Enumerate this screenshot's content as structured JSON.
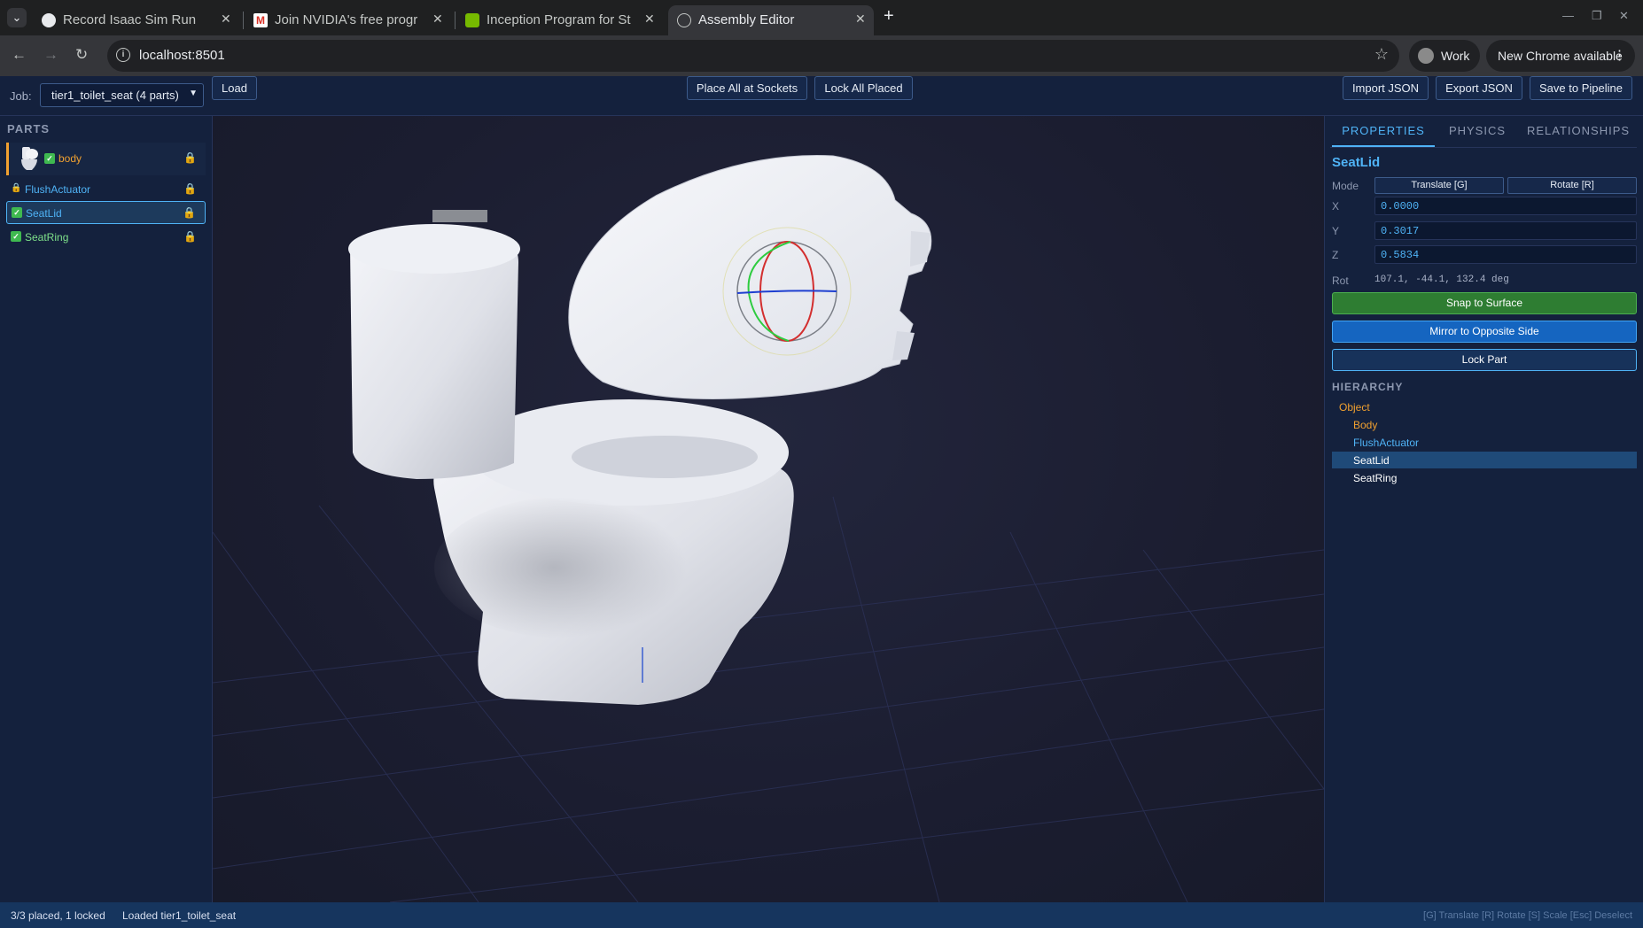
{
  "browser": {
    "tabs": [
      {
        "title": "Record Isaac Sim Run",
        "favicon": "chatgpt-icon"
      },
      {
        "title": "Join NVIDIA's free progr",
        "favicon": "gmail-icon"
      },
      {
        "title": "Inception Program for St",
        "favicon": "nvidia-icon"
      },
      {
        "title": "Assembly Editor",
        "favicon": "globe-icon",
        "active": true
      }
    ],
    "url": "localhost:8501",
    "profile_label": "Work",
    "update_label": "New Chrome available"
  },
  "toolbar": {
    "job_label": "Job:",
    "job_value": "tier1_toilet_seat (4 parts)",
    "load_label": "Load",
    "place_all_label": "Place All at Sockets",
    "lock_all_label": "Lock All Placed",
    "import_label": "Import JSON",
    "export_label": "Export JSON",
    "save_label": "Save to Pipeline"
  },
  "parts_panel": {
    "title": "PARTS",
    "items": [
      {
        "name": "body",
        "status": "placed",
        "locked": true,
        "thumbnail": "toilet-thumbnail"
      },
      {
        "name": "FlushActuator",
        "status": "locked",
        "locked": true
      },
      {
        "name": "SeatLid",
        "status": "placed",
        "locked": true,
        "selected": true
      },
      {
        "name": "SeatRing",
        "status": "placed",
        "locked": true
      }
    ]
  },
  "properties": {
    "tabs": [
      "PROPERTIES",
      "PHYSICS",
      "RELATIONSHIPS"
    ],
    "active_tab": "PROPERTIES",
    "selected_name": "SeatLid",
    "mode_label": "Mode",
    "mode_translate": "Translate [G]",
    "mode_rotate": "Rotate [R]",
    "x_label": "X",
    "y_label": "Y",
    "z_label": "Z",
    "x_value": "0.0000",
    "y_value": "0.3017",
    "z_value": "0.5834",
    "rot_label": "Rot",
    "rot_value": "107.1, -44.1, 132.4 deg",
    "snap_label": "Snap to Surface",
    "mirror_label": "Mirror to Opposite Side",
    "lock_label": "Lock Part",
    "hierarchy_title": "HIERARCHY",
    "hierarchy": [
      {
        "name": "Object",
        "level": 0
      },
      {
        "name": "Body",
        "level": 1
      },
      {
        "name": "FlushActuator",
        "level": 1
      },
      {
        "name": "SeatLid",
        "level": 1,
        "selected": true
      },
      {
        "name": "SeatRing",
        "level": 1
      }
    ]
  },
  "status": {
    "placed": "3/3 placed, 1 locked",
    "message": "Loaded tier1_toilet_seat",
    "hint": "[G] Translate [R] Rotate [S] Scale [Esc] Deselect"
  },
  "colors": {
    "accent": "#4fb3f6",
    "snap_button": "#2e7d32",
    "mirror_button": "#1565c0",
    "lock_amber": "#e3b341",
    "panel_bg": "#14213d",
    "status_bg": "#16355e"
  }
}
